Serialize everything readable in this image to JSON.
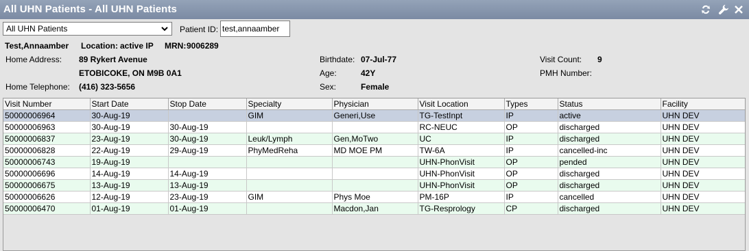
{
  "window": {
    "title": "All UHN Patients - All UHN Patients"
  },
  "toolbar": {
    "icons": [
      "refresh-icon",
      "wrench-icon",
      "close-icon"
    ]
  },
  "filter": {
    "list_value": "All UHN Patients",
    "patient_id_label": "Patient ID:",
    "patient_id_value": "test,annaamber"
  },
  "patient": {
    "name": "Test,Annaamber",
    "location_label": "Location:",
    "location_value": "active IP",
    "mrn_label": "MRN:",
    "mrn_value": "9006289",
    "home_address_label": "Home Address:",
    "address_line1": "89 Rykert Avenue",
    "address_line2": "ETOBICOKE, ON  M9B 0A1",
    "home_telephone_label": "Home Telephone:",
    "home_telephone": "(416) 323-5656",
    "birthdate_label": "Birthdate:",
    "birthdate": "07-Jul-77",
    "age_label": "Age:",
    "age": "42Y",
    "sex_label": "Sex:",
    "sex": "Female",
    "visit_count_label": "Visit Count:",
    "visit_count": "9",
    "pmh_label": "PMH Number:"
  },
  "visits": {
    "columns": [
      "Visit Number",
      "Start Date",
      "Stop Date",
      "Specialty",
      "Physician",
      "Visit Location",
      "Types",
      "Status",
      "Facility"
    ],
    "rows": [
      [
        "50000006964",
        "30-Aug-19",
        "",
        "GIM",
        "Generi,Use",
        "TG-TestInpt",
        "IP",
        "active",
        "UHN DEV"
      ],
      [
        "50000006963",
        "30-Aug-19",
        "30-Aug-19",
        "",
        "",
        "RC-NEUC",
        "OP",
        "discharged",
        "UHN DEV"
      ],
      [
        "50000006837",
        "23-Aug-19",
        "30-Aug-19",
        "Leuk/Lymph",
        "Gen,MoTwo",
        "UC",
        "IP",
        "discharged",
        "UHN DEV"
      ],
      [
        "50000006828",
        "22-Aug-19",
        "29-Aug-19",
        "PhyMedReha",
        "MD MOE PM",
        "TW-6A",
        "IP",
        "cancelled-inc",
        "UHN DEV"
      ],
      [
        "50000006743",
        "19-Aug-19",
        "",
        "",
        "",
        "UHN-PhonVisit",
        "OP",
        "pended",
        "UHN DEV"
      ],
      [
        "50000006696",
        "14-Aug-19",
        "14-Aug-19",
        "",
        "",
        "UHN-PhonVisit",
        "OP",
        "discharged",
        "UHN DEV"
      ],
      [
        "50000006675",
        "13-Aug-19",
        "13-Aug-19",
        "",
        "",
        "UHN-PhonVisit",
        "OP",
        "discharged",
        "UHN DEV"
      ],
      [
        "50000006626",
        "12-Aug-19",
        "23-Aug-19",
        "GIM",
        "Phys Moe",
        "PM-16P",
        "IP",
        "cancelled",
        "UHN DEV"
      ],
      [
        "50000006470",
        "01-Aug-19",
        "01-Aug-19",
        "",
        "Macdon,Jan",
        "TG-Resprology",
        "CP",
        "discharged",
        "UHN DEV"
      ]
    ]
  }
}
